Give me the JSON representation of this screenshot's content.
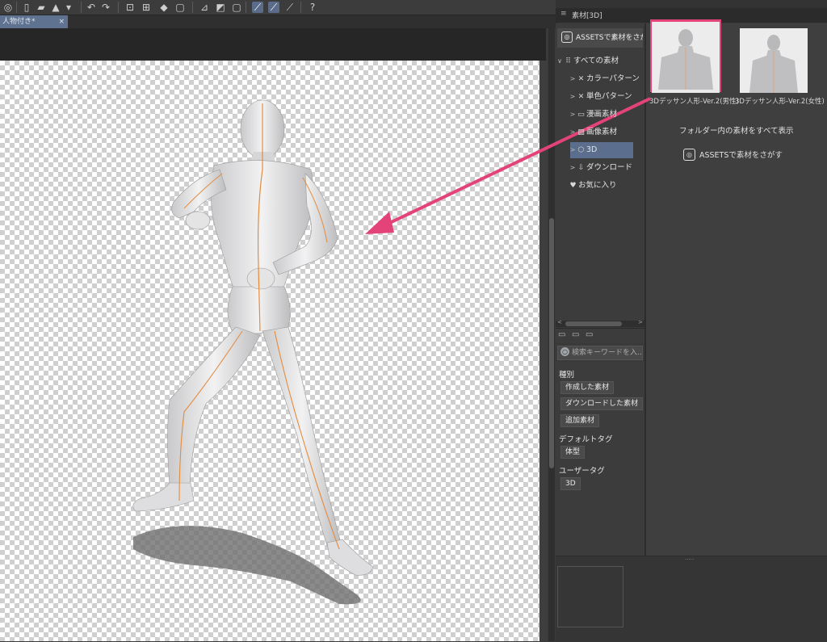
{
  "document": {
    "tab_title": "人物付き*",
    "tab_close": "×"
  },
  "toolbar": {
    "icons": [
      "assets-icon",
      "new-file-icon",
      "save-icon",
      "clear-icon",
      "dropdown-icon",
      "undo-icon",
      "redo-icon",
      "transform-icon",
      "free-transform-icon",
      "fill-icon",
      "deselect-icon",
      "crop-icon",
      "invert-icon",
      "ruler-icon",
      "snap-ruler-icon",
      "snap-special-icon",
      "snap-grid-icon",
      "help-icon"
    ]
  },
  "panel": {
    "title": "素材[3D]",
    "menu_icon": "≡",
    "assets_button": "ASSETSで素材をさがす",
    "tree": [
      {
        "label": "すべての素材",
        "arrow": "∨",
        "icon": "⠿"
      },
      {
        "label": "カラーパターン",
        "arrow": ">",
        "icon": "✕"
      },
      {
        "label": "単色パターン",
        "arrow": ">",
        "icon": "✕"
      },
      {
        "label": "漫画素材",
        "arrow": ">",
        "icon": "▭"
      },
      {
        "label": "画像素材",
        "arrow": ">",
        "icon": "▨"
      },
      {
        "label": "3D",
        "arrow": ">",
        "icon": "⬡"
      },
      {
        "label": "ダウンロード",
        "arrow": ">",
        "icon": "⇩"
      },
      {
        "label": "お気に入り",
        "arrow": "",
        "icon": "♥"
      }
    ],
    "search_placeholder": "検索キーワードを入...",
    "filters": {
      "type_heading": "種別",
      "type_chips": [
        "作成した素材",
        "ダウンロードした素材",
        "追加素材"
      ],
      "default_tag_heading": "デフォルトタグ",
      "default_tag_chips": [
        "体型"
      ],
      "user_tag_heading": "ユーザータグ",
      "user_tag_chips": [
        "3D"
      ]
    },
    "materials": [
      {
        "label": "3Dデッサン人形-Ver.2(男性)",
        "selected": true
      },
      {
        "label": "3Dデッサン人形-Ver.2(女性)",
        "selected": false
      }
    ],
    "show_all_label": "フォルダー内の素材をすべて表示",
    "assets_link": "ASSETSで素材をさがす"
  },
  "colors": {
    "highlight": "#e4437a",
    "selection": "#5c6e8e",
    "tab_active": "#5f7290"
  }
}
